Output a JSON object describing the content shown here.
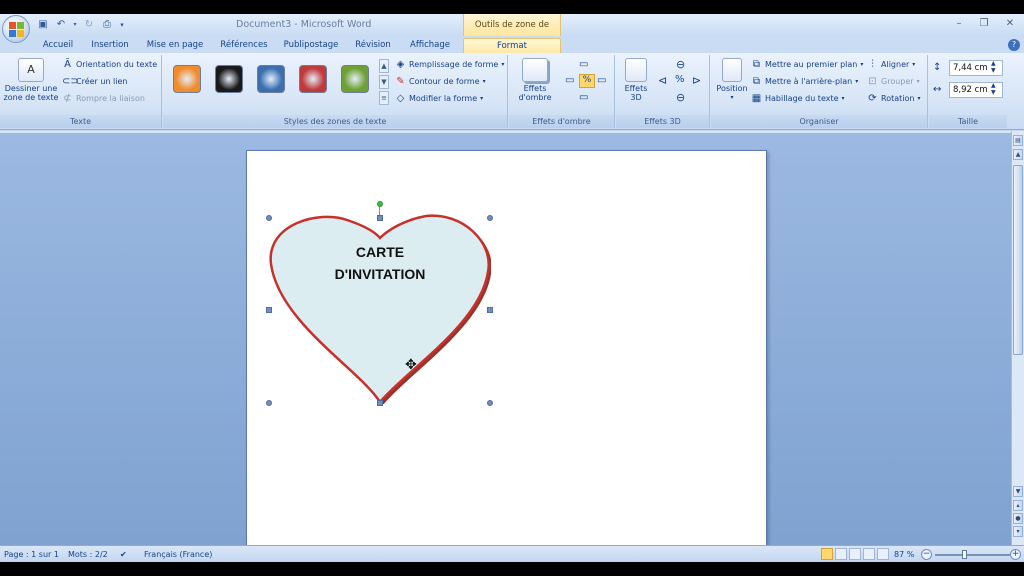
{
  "window": {
    "title": "Document3 - Microsoft Word",
    "contextual_group": "Outils de zone de texte",
    "controls": [
      "–",
      "❐",
      "✕"
    ]
  },
  "quick_access": [
    "save-icon",
    "undo-icon",
    "redo-icon",
    "print-preview-icon",
    "customize-icon"
  ],
  "tabs": [
    {
      "label": "Accueil"
    },
    {
      "label": "Insertion"
    },
    {
      "label": "Mise en page"
    },
    {
      "label": "Références"
    },
    {
      "label": "Publipostage"
    },
    {
      "label": "Révision"
    },
    {
      "label": "Affichage"
    },
    {
      "label": "Format",
      "active": true
    }
  ],
  "ribbon": {
    "texte": {
      "label": "Texte",
      "draw_textbox": "Dessiner une zone de texte",
      "draw_textbox_l1": "Dessiner une",
      "draw_textbox_l2": "zone de texte",
      "orientation": "Orientation du texte",
      "create_link": "Créer un lien",
      "break_link": "Rompre la liaison"
    },
    "styles": {
      "label": "Styles des zones de texte",
      "swatches": [
        "#f08c2e",
        "#1a1a1a",
        "#3b6fb0",
        "#c0393b",
        "#6fa033"
      ],
      "fill": "Remplissage de forme",
      "outline": "Contour de forme",
      "modify": "Modifier la forme"
    },
    "shadow": {
      "label": "Effets d'ombre",
      "button_l1": "Effets",
      "button_l2": "d'ombre"
    },
    "effects3d": {
      "label": "Effets 3D",
      "button_l1": "Effets",
      "button_l2": "3D"
    },
    "organiser": {
      "label": "Organiser",
      "position": "Position",
      "bring_front": "Mettre au premier plan",
      "send_back": "Mettre à l'arrière-plan",
      "wrap": "Habillage du texte",
      "align": "Aligner",
      "group": "Grouper",
      "rotate": "Rotation"
    },
    "taille": {
      "label": "Taille",
      "height": "7,44 cm",
      "width": "8,92 cm"
    }
  },
  "document": {
    "heart_line1": "CARTE",
    "heart_line2": "D'INVITATION",
    "heart_fill": "#dcedf2",
    "heart_stroke": "#c8302a"
  },
  "status": {
    "page": "Page : 1 sur 1",
    "words": "Mots : 2/2",
    "language": "Français (France)",
    "zoom": "87 %"
  }
}
